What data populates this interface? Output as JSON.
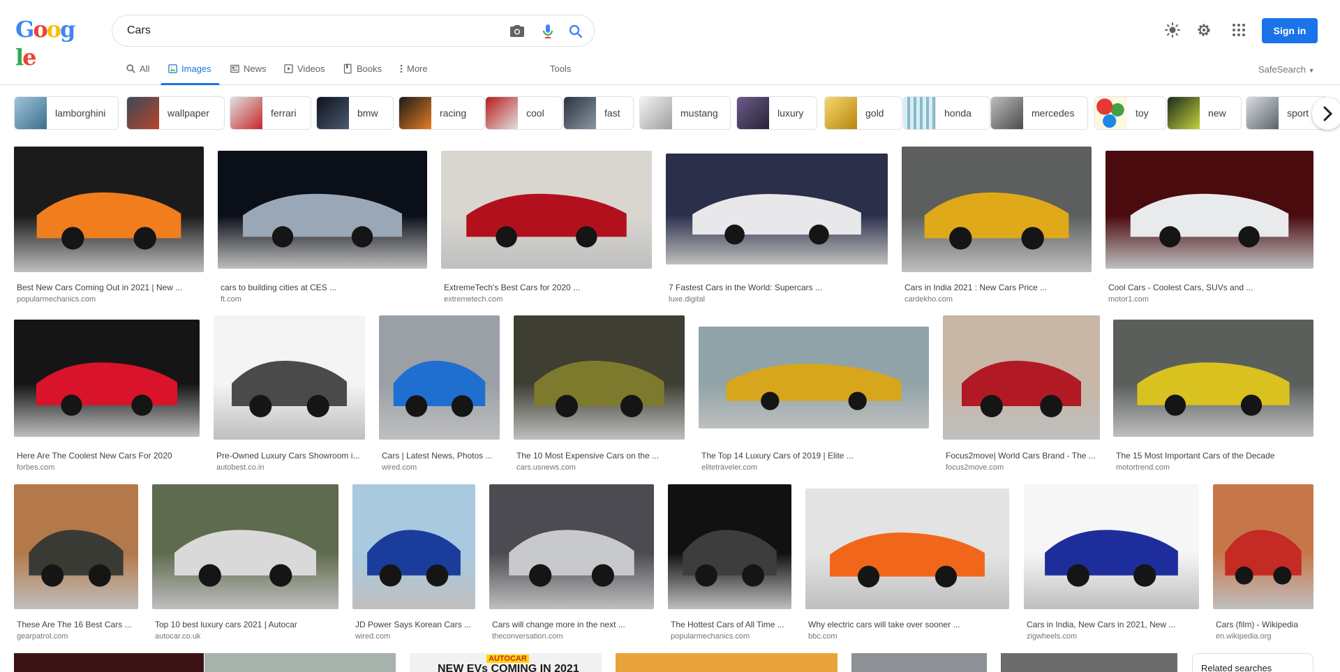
{
  "search": {
    "query": "Cars"
  },
  "header": {
    "sign_in": "Sign in",
    "logo_text": "Google"
  },
  "tabs": [
    {
      "label": "All",
      "icon": "search-icon"
    },
    {
      "label": "Images",
      "icon": "image-icon",
      "active": true
    },
    {
      "label": "News",
      "icon": "news-icon"
    },
    {
      "label": "Videos",
      "icon": "video-icon"
    },
    {
      "label": "Books",
      "icon": "book-icon"
    },
    {
      "label": "More",
      "icon": "more-icon"
    },
    {
      "label": "Tools"
    }
  ],
  "safesearch": "SafeSearch",
  "chips": [
    {
      "label": "lamborghini",
      "color": "#3b6f8f"
    },
    {
      "label": "wallpaper",
      "color": "#b8452a"
    },
    {
      "label": "ferrari",
      "color": "#c62828"
    },
    {
      "label": "bmw",
      "color": "#1f2a3a"
    },
    {
      "label": "racing",
      "color": "#e67e22"
    },
    {
      "label": "cool",
      "color": "#b71c1c"
    },
    {
      "label": "fast",
      "color": "#5f6b7a"
    },
    {
      "label": "mustang",
      "color": "#bdbdbd"
    },
    {
      "label": "luxury",
      "color": "#4a3b6b"
    },
    {
      "label": "gold",
      "color": "#d4a017"
    },
    {
      "label": "honda",
      "color": "#9ec9d8"
    },
    {
      "label": "mercedes",
      "color": "#6d6d6d"
    },
    {
      "label": "toy",
      "color": "#e53935"
    },
    {
      "label": "new",
      "color": "#c6d23a"
    },
    {
      "label": "sport",
      "color": "#8a8f96"
    }
  ],
  "results": [
    {
      "title": "Best New Cars Coming Out in 2021 | New ...",
      "source": "popularmechanics.com",
      "bg": "#1b1b1b",
      "car": "#f07d1e"
    },
    {
      "title": "cars to building cities at CES ...",
      "source": "ft.com",
      "bg": "#0b0f18",
      "car": "#9aa7b6"
    },
    {
      "title": "ExtremeTech's Best Cars for 2020 ...",
      "source": "extremetech.com",
      "bg": "#d9d6d0",
      "car": "#b3101d"
    },
    {
      "title": "7 Fastest Cars in the World: Supercars ...",
      "source": "luxe.digital",
      "bg": "#2b2f4a",
      "car": "#e8e8ea"
    },
    {
      "title": "Cars in India 2021 : New Cars Price ...",
      "source": "cardekho.com",
      "bg": "#5c5f5e",
      "car": "#e0a91a"
    },
    {
      "title": "Cool Cars - Coolest Cars, SUVs and ...",
      "source": "motor1.com",
      "bg": "#4a0b0e",
      "car": "#e9eaec"
    },
    {
      "title": "Here Are The Coolest New Cars For 2020",
      "source": "forbes.com",
      "bg": "#151515",
      "car": "#d8132a"
    },
    {
      "title": "Pre-Owned Luxury Cars Showroom i...",
      "source": "autobest.co.in",
      "bg": "#f4f4f4",
      "car": "#4a4a4a"
    },
    {
      "title": "Cars | Latest News, Photos ...",
      "source": "wired.com",
      "bg": "#9aa0a6",
      "car": "#1f6fd1"
    },
    {
      "title": "The 10 Most Expensive Cars on the ...",
      "source": "cars.usnews.com",
      "bg": "#3e3e32",
      "car": "#7d7a2e"
    },
    {
      "title": "The Top 14 Luxury Cars of 2019 | Elite ...",
      "source": "elitetraveler.com",
      "bg": "#8fa3a8",
      "car": "#d7a61c"
    },
    {
      "title": "Focus2move| World Cars Brand - The ...",
      "source": "focus2move.com",
      "bg": "#c8b6a6",
      "car": "#b11a25"
    },
    {
      "title": "The 15 Most Important Cars of the Decade",
      "source": "motortrend.com",
      "bg": "#5a5f5c",
      "car": "#d9c21f"
    },
    {
      "title": "These Are The 16 Best Cars ...",
      "source": "gearpatrol.com",
      "bg": "#b3794a",
      "car": "#3a3a34"
    },
    {
      "title": "Top 10 best luxury cars 2021 | Autocar",
      "source": "autocar.co.uk",
      "bg": "#5f6b4e",
      "car": "#d9d9d9"
    },
    {
      "title": "JD Power Says Korean Cars ...",
      "source": "wired.com",
      "bg": "#a8c9de",
      "car": "#1a3d9b"
    },
    {
      "title": "Cars will change more in the next ...",
      "source": "theconversation.com",
      "bg": "#4d4b52",
      "car": "#c7c9cc"
    },
    {
      "title": "The Hottest Cars of All Time ...",
      "source": "popularmechanics.com",
      "bg": "#111111",
      "car": "#3d3d3d"
    },
    {
      "title": "Why electric cars will take over sooner ...",
      "source": "bbc.com",
      "bg": "#e3e3e3",
      "car": "#f0671c"
    },
    {
      "title": "Cars in India, New Cars in 2021, New ...",
      "source": "zigwheels.com",
      "bg": "#f6f6f6",
      "car": "#1d2e9c"
    },
    {
      "title": "Cars (film) - Wikipedia",
      "source": "en.wikipedia.org",
      "bg": "#c6774a",
      "car": "#c62a24"
    }
  ],
  "partial_row": [
    {
      "bg": "#3b1214"
    },
    {
      "bg": "#a7b2ad"
    },
    {
      "bg": "#f1f1f1",
      "label": "NEW EVs COMING IN 2021",
      "brand": "AUTOCAR"
    },
    {
      "bg": "#e8a43a"
    },
    {
      "bg": "#8d9094"
    },
    {
      "bg": "#6b6b6b"
    }
  ],
  "related": "Related searches"
}
